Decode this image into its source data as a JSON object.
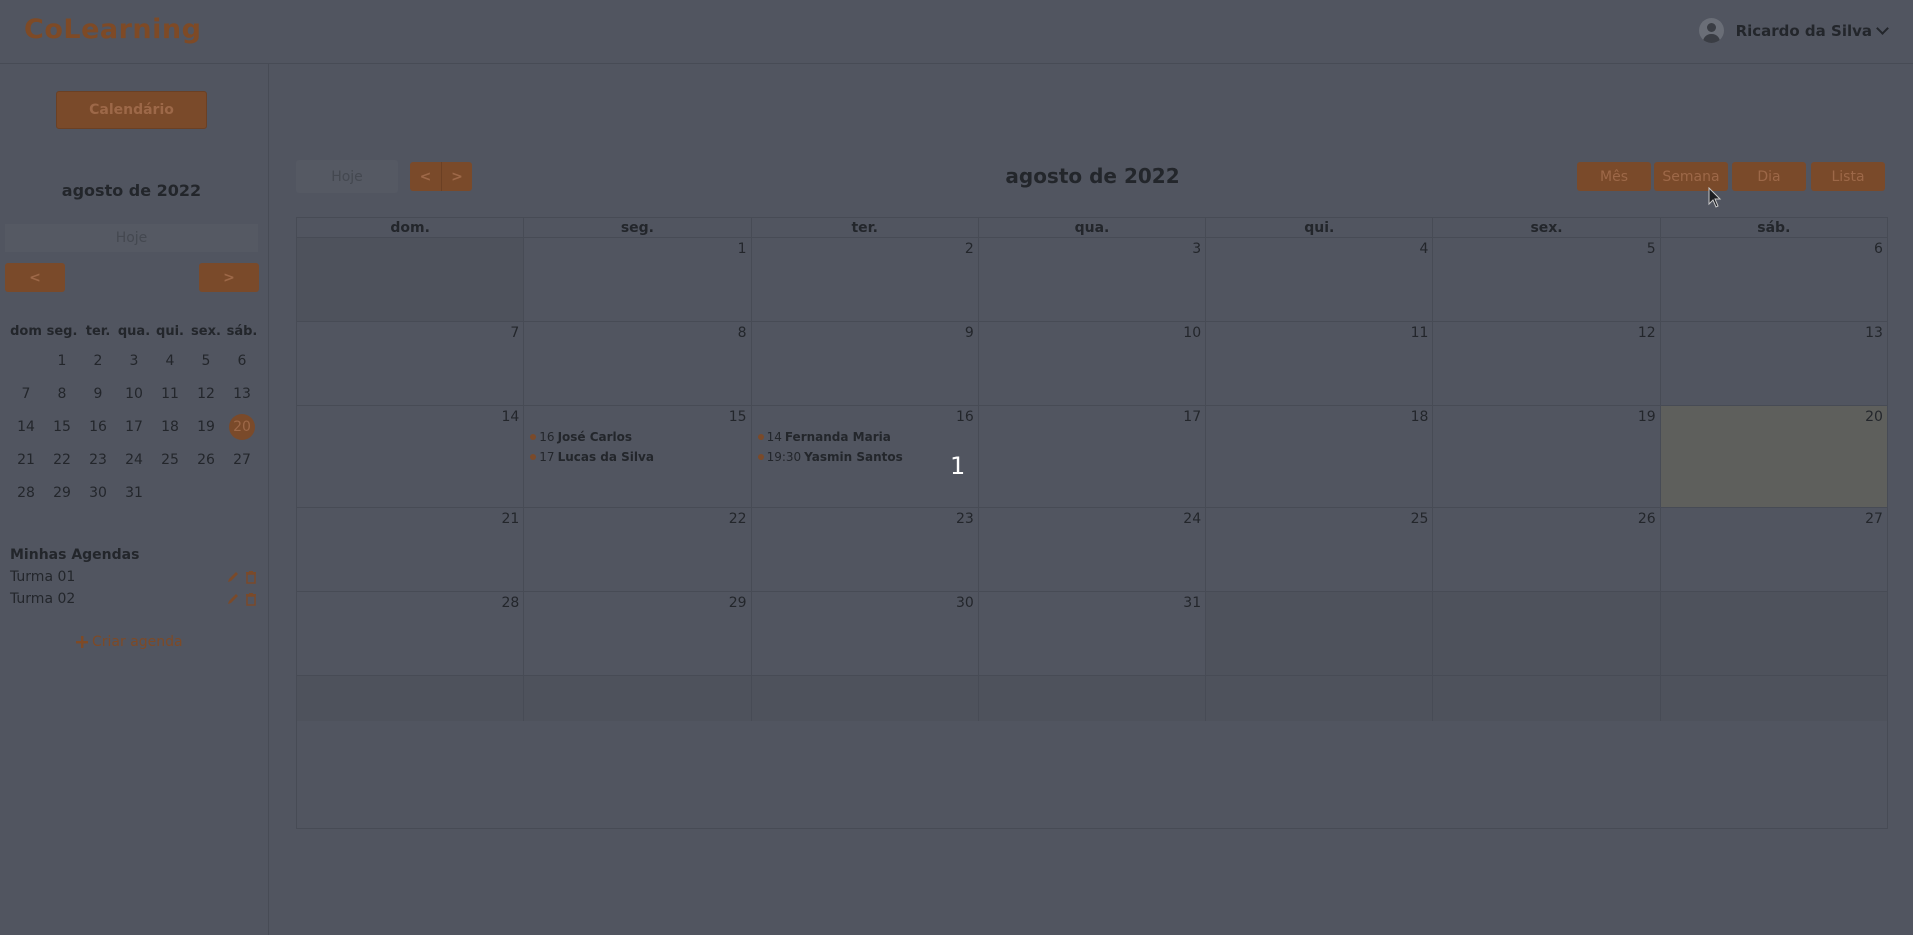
{
  "app": {
    "logo": "CoLearning"
  },
  "user": {
    "name": "Ricardo da Silva"
  },
  "sidebar": {
    "calendar_button": "Calendário",
    "mini_calendar": {
      "title": "agosto de 2022",
      "today_label": "Hoje",
      "prev_label": "<",
      "next_label": ">",
      "weekdays": [
        "dom",
        "seg.",
        "ter.",
        "qua.",
        "qui.",
        "sex.",
        "sáb."
      ],
      "weeks": [
        [
          "",
          "1",
          "2",
          "3",
          "4",
          "5",
          "6"
        ],
        [
          "7",
          "8",
          "9",
          "10",
          "11",
          "12",
          "13"
        ],
        [
          "14",
          "15",
          "16",
          "17",
          "18",
          "19",
          "20"
        ],
        [
          "21",
          "22",
          "23",
          "24",
          "25",
          "26",
          "27"
        ],
        [
          "28",
          "29",
          "30",
          "31",
          "",
          "",
          ""
        ]
      ],
      "selected_day": "20"
    },
    "agendas_title": "Minhas Agendas",
    "agendas": [
      "Turma 01",
      "Turma 02"
    ],
    "create_label": "Criar agenda"
  },
  "main": {
    "today_label": "Hoje",
    "prev_label": "<",
    "next_label": ">",
    "title": "agosto de 2022",
    "views": [
      "Mês",
      "Semana",
      "Dia",
      "Lista"
    ],
    "weekdays": [
      "dom.",
      "seg.",
      "ter.",
      "qua.",
      "qui.",
      "sex.",
      "sáb."
    ],
    "weeks": [
      [
        "",
        "1",
        "2",
        "3",
        "4",
        "5",
        "6"
      ],
      [
        "7",
        "8",
        "9",
        "10",
        "11",
        "12",
        "13"
      ],
      [
        "14",
        "15",
        "16",
        "17",
        "18",
        "19",
        "20"
      ],
      [
        "21",
        "22",
        "23",
        "24",
        "25",
        "26",
        "27"
      ],
      [
        "28",
        "29",
        "30",
        "31",
        "",
        "",
        ""
      ],
      [
        "",
        "",
        "",
        "",
        "",
        "",
        ""
      ]
    ],
    "events": {
      "15": [
        {
          "time": "16",
          "title": "José Carlos"
        },
        {
          "time": "17",
          "title": "Lucas da Silva"
        }
      ],
      "16": [
        {
          "time": "14",
          "title": "Fernanda Maria"
        },
        {
          "time": "19:30",
          "title": "Yasmin Santos"
        }
      ]
    },
    "highlight_day": "20",
    "overlay_number": "1"
  },
  "colors": {
    "accent": "#7a4a2a",
    "background": "#515560"
  }
}
